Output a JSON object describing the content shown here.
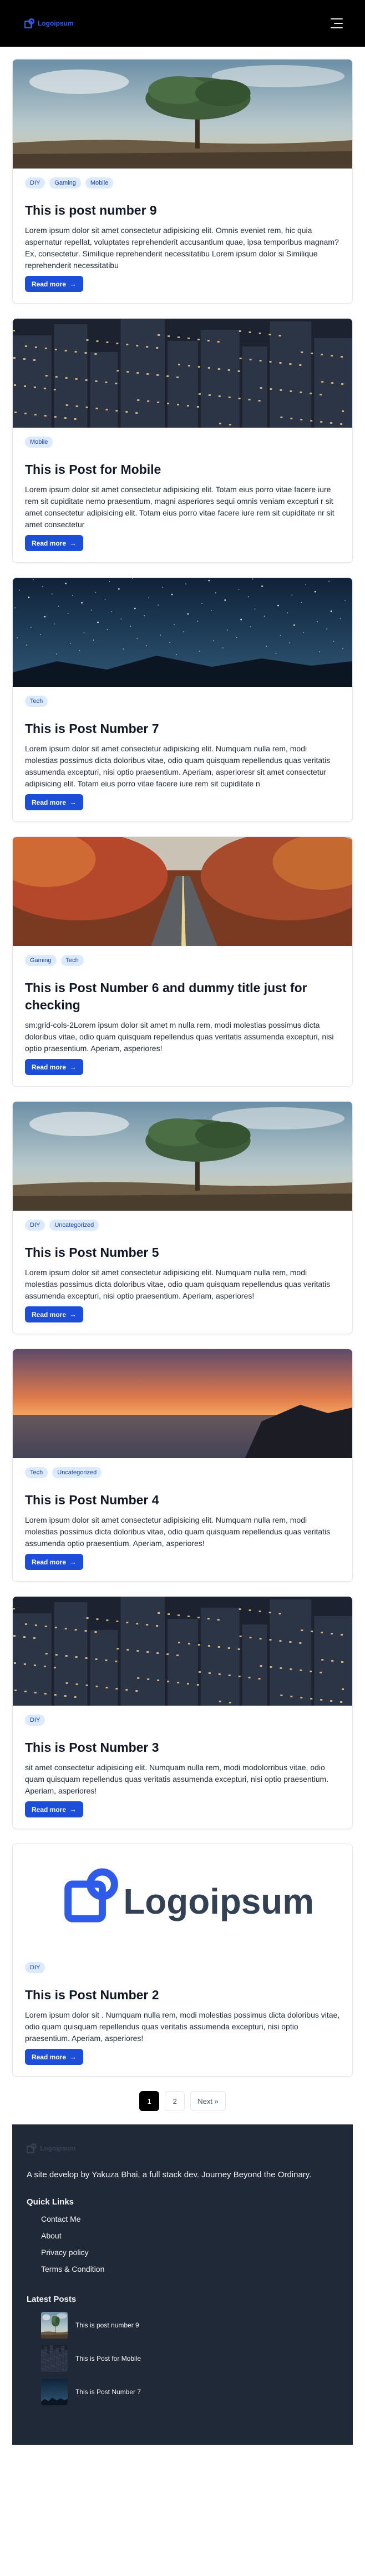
{
  "header": {
    "logo_text": "Logoipsum"
  },
  "posts": [
    {
      "title": "This is post number 9",
      "tags": [
        "DIY",
        "Gaming",
        "Mobile"
      ],
      "excerpt": "Lorem ipsum dolor sit amet consectetur adipisicing elit. Omnis eveniet rem, hic quia aspernatur repellat, voluptates reprehenderit accusantium quae, ipsa temporibus magnam? Ex, consectetur. Similique reprehenderit necessitatibu Lorem ipsum dolor si Similique reprehenderit necessitatibu",
      "read_more": "Read more",
      "image": "tree"
    },
    {
      "title": "This is Post for Mobile",
      "tags": [
        "Mobile"
      ],
      "excerpt": "Lorem ipsum dolor sit amet consectetur adipisicing elit. Totam eius porro vitae facere iure rem sit cupiditate nemo praesentium, magni asperiores sequi omnis veniam excepturi r sit amet consectetur adipisicing elit. Totam eius porro vitae facere iure rem sit cupiditate nr sit amet consectetur",
      "read_more": "Read more",
      "image": "city"
    },
    {
      "title": "This is Post Number 7",
      "tags": [
        "Tech"
      ],
      "excerpt": "Lorem ipsum dolor sit amet consectetur adipisicing elit. Numquam nulla rem, modi molestias possimus dicta doloribus vitae, odio quam quisquam repellendus quas veritatis assumenda excepturi, nisi optio praesentium. Aperiam, asperioresr sit amet consectetur adipisicing elit. Totam eius porro vitae facere iure rem sit cupiditate n",
      "read_more": "Read more",
      "image": "stars"
    },
    {
      "title": "This is Post Number 6 and dummy title just for checking",
      "tags": [
        "Gaming",
        "Tech"
      ],
      "excerpt": "sm:grid-cols-2Lorem ipsum dolor sit amet m nulla rem, modi molestias possimus dicta doloribus vitae, odio quam quisquam repellendus quas veritatis assumenda excepturi, nisi optio praesentium. Aperiam, asperiores!",
      "read_more": "Read more",
      "image": "road"
    },
    {
      "title": "This is Post Number 5",
      "tags": [
        "DIY",
        "Uncategorized"
      ],
      "excerpt": "Lorem ipsum dolor sit amet consectetur adipisicing elit. Numquam nulla rem, modi molestias possimus dicta doloribus vitae, odio quam quisquam repellendus quas veritatis assumenda excepturi, nisi optio praesentium. Aperiam, asperiores!",
      "read_more": "Read more",
      "image": "tree"
    },
    {
      "title": "This is Post Number 4",
      "tags": [
        "Tech",
        "Uncategorized"
      ],
      "excerpt": "Lorem ipsum dolor sit amet consectetur adipisicing elit. Numquam nulla rem, modi molestias possimus dicta doloribus vitae, odio quam quisquam repellendus quas veritatis assumenda optio praesentium. Aperiam, asperiores!",
      "read_more": "Read more",
      "image": "sunset"
    },
    {
      "title": "This is Post Number 3",
      "tags": [
        "DIY"
      ],
      "excerpt": "sit amet consectetur adipisicing elit. Numquam nulla rem, modi modolorribus vitae, odio quam quisquam repellendus quas veritatis assumenda excepturi, nisi optio praesentium. Aperiam, asperiores!",
      "read_more": "Read more",
      "image": "city"
    },
    {
      "title": "This is Post Number 2",
      "tags": [
        "DIY"
      ],
      "excerpt": "Lorem ipsum dolor sit . Numquam nulla rem, modi molestias possimus dicta doloribus vitae, odio quam quisquam repellendus quas veritatis assumenda excepturi, nisi optio praesentium. Aperiam, asperiores!",
      "read_more": "Read more",
      "image": "logo",
      "image_logo_text": "Logoipsum"
    }
  ],
  "pagination": {
    "pages": [
      "1",
      "2"
    ],
    "next_label": "Next »",
    "current": "1"
  },
  "footer": {
    "logo_text": "Logoipsum",
    "tagline": "A site develop by Yakuza Bhai, a full stack dev. Journey Beyond the Ordinary.",
    "quick_links_title": "Quick Links",
    "quick_links": [
      "Contact Me",
      "About",
      "Privacy policy",
      "Terms & Condition"
    ],
    "latest_title": "Latest Posts",
    "latest_posts": [
      {
        "title": "This is post number 9",
        "image": "tree"
      },
      {
        "title": "This is Post for Mobile",
        "image": "city"
      },
      {
        "title": "This is Post Number 7",
        "image": "stars"
      }
    ]
  },
  "colors": {
    "accent": "#1d4ed8",
    "header_bg": "#000000",
    "footer_bg": "#1f2937",
    "tag_bg": "#dbeafe",
    "tag_text": "#1e40af"
  }
}
